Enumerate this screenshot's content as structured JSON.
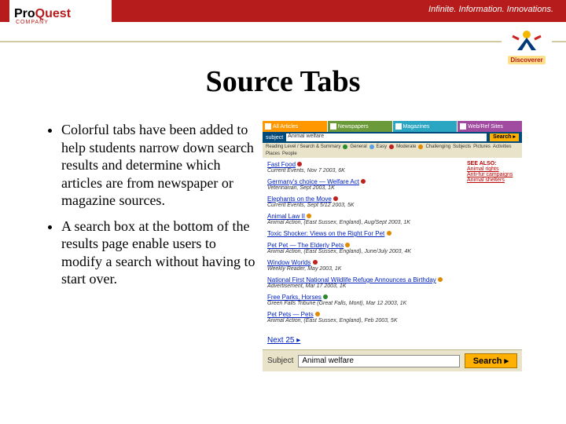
{
  "header": {
    "logo_main": "Pro",
    "logo_accent": "Quest",
    "logo_sub": "COMPANY",
    "tagline": "Infinite. Information. Innovations.",
    "badge": "Discoverer"
  },
  "title": "Source Tabs",
  "bullets": [
    "Colorful tabs have been added to help students narrow down search results and determine which articles are from newspaper or magazine sources.",
    "A search box at the bottom of the results page enable users to modify a search without having to start over."
  ],
  "mini": {
    "tabs": [
      "All Articles",
      "Newspapers",
      "Magazines",
      "Web/Ref Sites"
    ],
    "subbar_label": "subject",
    "subbar_value": "Animal welfare",
    "search_label": "Search",
    "filter_row_label": "Reading Level / Search & Summary",
    "filters": [
      "General",
      "Easy",
      "Moderate",
      "Challenging",
      "Subjects",
      "Pictures",
      "Activities",
      "Places",
      "People"
    ],
    "see_also": "SEE ALSO:",
    "see_links": [
      "Animal rights",
      "Anti-fur campaigns",
      "Animal shelters"
    ],
    "results": [
      {
        "t": "Fast Food",
        "m": "Current Events, Nov 7 2003, 6K"
      },
      {
        "t": "Germany's choice — Welfare Act",
        "m": "Veterinarian, Sept 2003, 1K"
      },
      {
        "t": "Elephants on the Move",
        "m": "Current Events, Sept 5/12 2003, 5K"
      },
      {
        "t": "Animal Law II",
        "m": "Animal Action, (East Sussex, England), Aug/Sept 2003, 1K"
      },
      {
        "t": "Toxic Shocker: Views on the Right For Pet",
        "m": ""
      },
      {
        "t": "Pet Pet — The Elderly Pets",
        "m": "Animal Action, (East Sussex, England), June/July 2003, 4K"
      },
      {
        "t": "Window Worlds",
        "m": "Weekly Reader, May 2003, 1K"
      },
      {
        "t": "National First National Wildlife Refuge Announces a Birthday",
        "m": "Advertisement, Mar 17 2003, 1K"
      },
      {
        "t": "Free Parks, Horses",
        "m": "Green Falls Tribune (Great Falls, Mont), Mar 12 2003, 1K"
      },
      {
        "t": "Pet Pets — Pets",
        "m": "Animal Action, (East Sussex, England), Feb 2003, 5K"
      }
    ],
    "next": "Next 25",
    "bottom_label": "Subject",
    "bottom_value": "Animal welfare",
    "bottom_button": "Search"
  }
}
